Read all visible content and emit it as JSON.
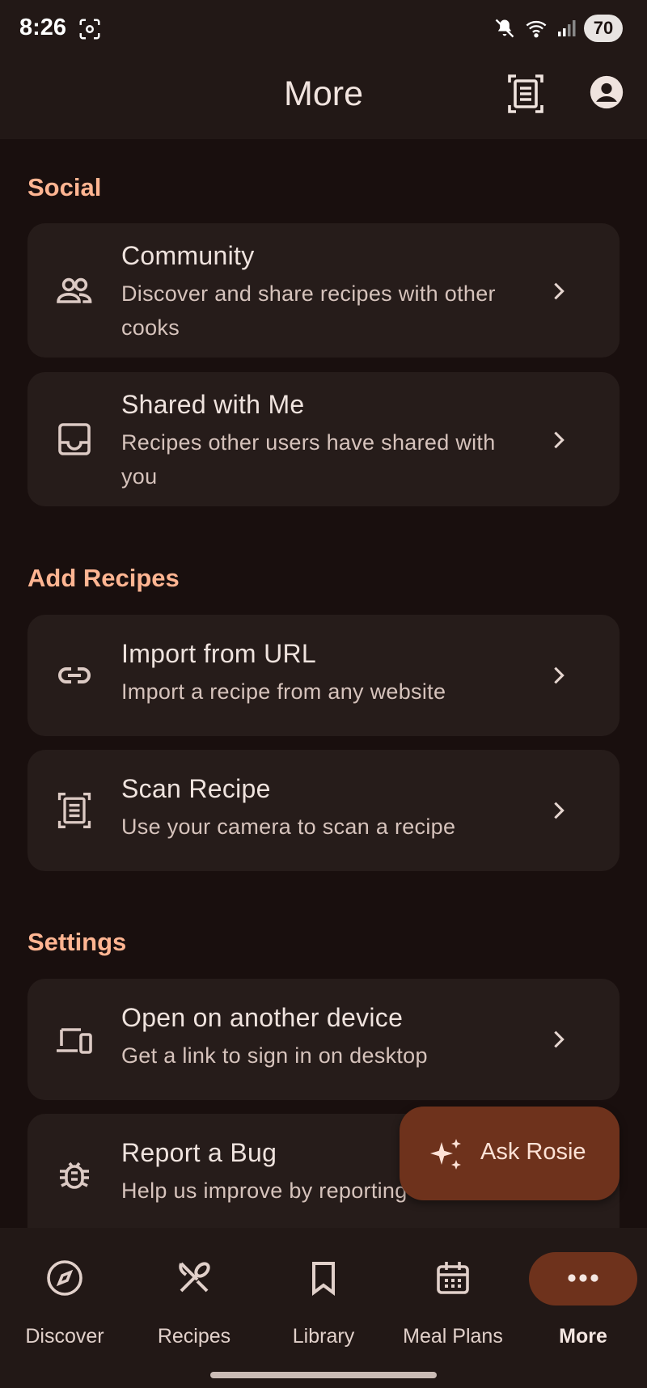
{
  "status_bar": {
    "time": "8:26",
    "battery": "70"
  },
  "app_bar": {
    "title": "More"
  },
  "sections": {
    "social": {
      "header": "Social",
      "community": {
        "title": "Community",
        "desc": "Discover and share recipes with other cooks"
      },
      "shared": {
        "title": "Shared with Me",
        "desc": "Recipes other users have shared with you"
      }
    },
    "add_recipes": {
      "header": "Add Recipes",
      "import_url": {
        "title": "Import from URL",
        "desc": "Import a recipe from any website"
      },
      "scan": {
        "title": "Scan Recipe",
        "desc": "Use your camera to scan a recipe"
      }
    },
    "settings": {
      "header": "Settings",
      "device": {
        "title": "Open on another device",
        "desc": "Get a link to sign in on desktop"
      },
      "bug": {
        "title": "Report a Bug",
        "desc": "Help us improve by reporting issues"
      }
    }
  },
  "fab": {
    "label": "Ask Rosie"
  },
  "bottom_nav": {
    "discover": "Discover",
    "recipes": "Recipes",
    "library": "Library",
    "meal_plans": "Meal Plans",
    "more": "More"
  },
  "colors": {
    "background": "#190f0e",
    "surface": "#261c1a",
    "accent": "#ffb592",
    "primary_container": "#6e321c"
  },
  "icons": {
    "community": "people-icon",
    "shared": "inbox-icon",
    "import_url": "link-icon",
    "scan": "document-scanner-icon",
    "device": "devices-icon",
    "bug": "bug-icon",
    "fab": "sparkle-icon"
  }
}
